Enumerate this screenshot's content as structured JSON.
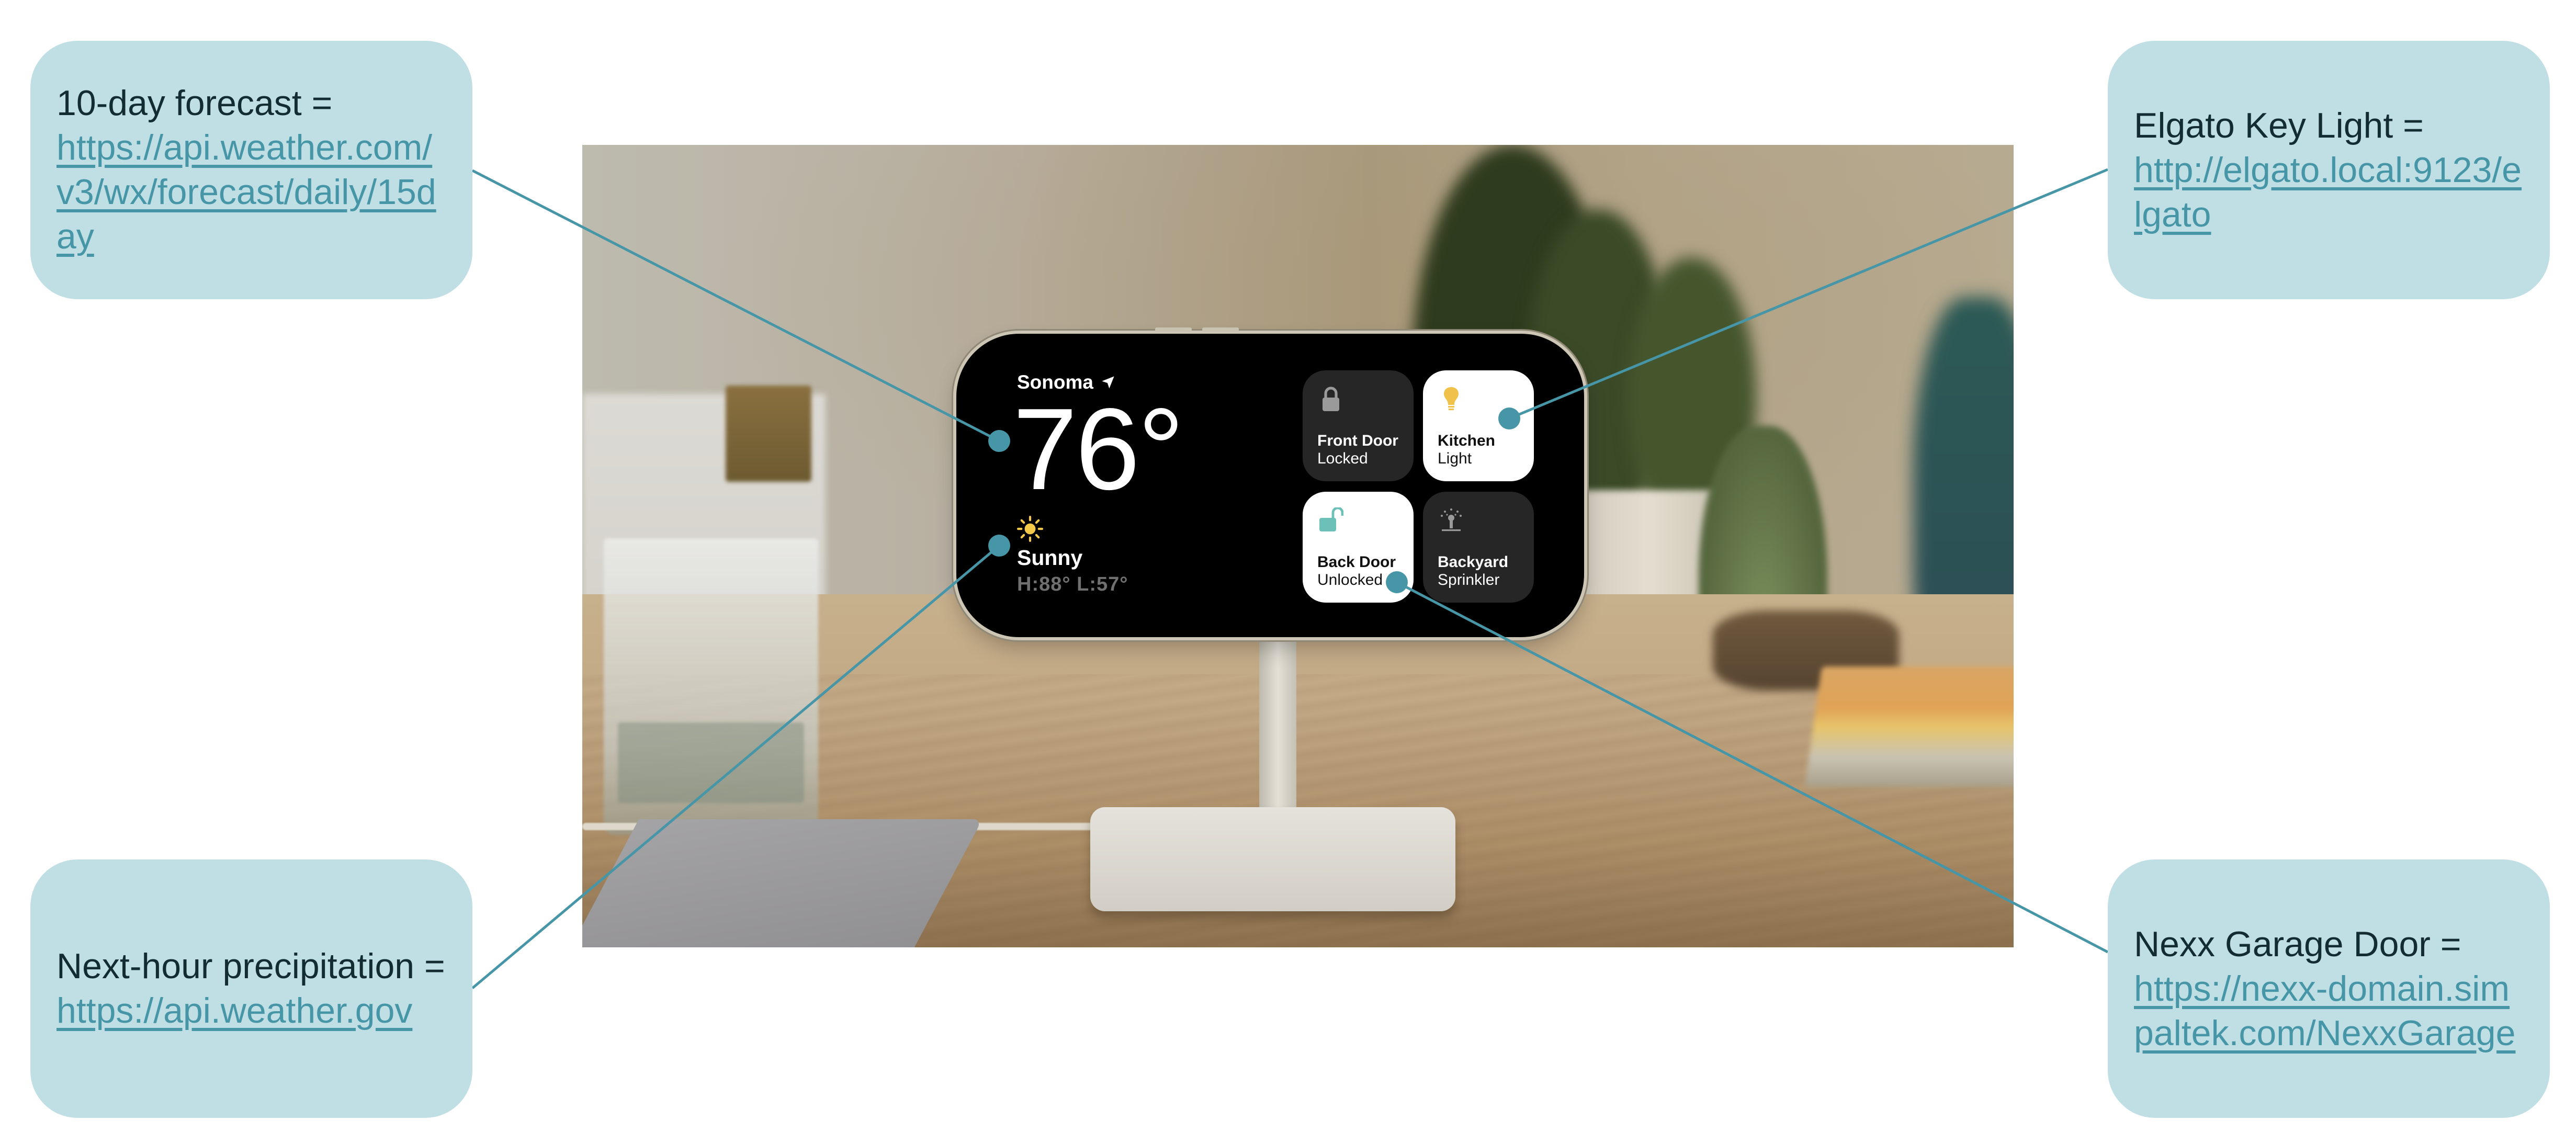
{
  "callouts": [
    {
      "id": "forecast",
      "label": "10-day forecast =",
      "url": "https://api.weather.com/v3/wx/forecast/daily/15day"
    },
    {
      "id": "precip",
      "label": "Next-hour precipitation =",
      "url": "https://api.weather.gov"
    },
    {
      "id": "keylight",
      "label": "Elgato Key Light =",
      "url": "http://elgato.local:9123/elgato"
    },
    {
      "id": "garage",
      "label": "Nexx Garage Door =",
      "url": "https://nexx-domain.simpaltek.com/NexxGarage"
    }
  ],
  "phone": {
    "location": "Sonoma",
    "temperature": "76°",
    "condition": "Sunny",
    "high_low": "H:88° L:57°",
    "tiles": [
      {
        "name": "Front Door",
        "state": "Locked",
        "icon": "lock-icon",
        "active": false
      },
      {
        "name": "Kitchen",
        "state": "Light",
        "icon": "lightbulb-icon",
        "active": true
      },
      {
        "name": "Back Door",
        "state": "Unlocked",
        "icon": "unlock-icon",
        "active": true
      },
      {
        "name": "Backyard",
        "state": "Sprinkler",
        "icon": "sprinkler-icon",
        "active": false
      }
    ]
  },
  "colors": {
    "callout_bg": "#bfdfe4",
    "link": "#4696a7",
    "connector": "#4696a7",
    "label_text": "#122c31"
  }
}
